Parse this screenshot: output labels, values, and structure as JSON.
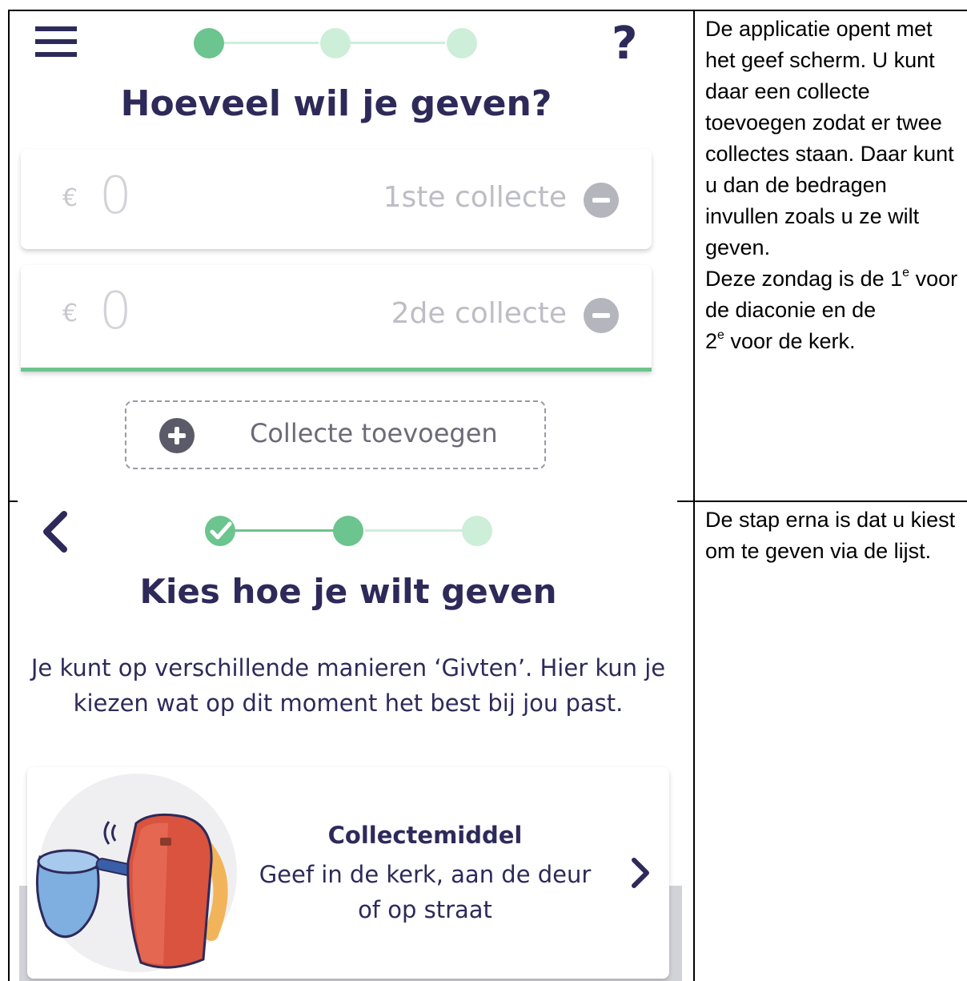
{
  "screen1": {
    "title": "Hoeveel wil je geven?",
    "help_label": "?",
    "collections": [
      {
        "currency": "€",
        "amount": "0",
        "label": "1ste collecte"
      },
      {
        "currency": "€",
        "amount": "0",
        "label": "2de collecte"
      }
    ],
    "add_label": "Collecte toevoegen",
    "steps_current": 1,
    "steps_total": 3
  },
  "note1": {
    "line1": "De applicatie opent met het geef scherm. U kunt daar een collecte toevoegen zodat er twee collectes staan. Daar kunt u dan de bedragen invullen zoals u ze wilt geven.",
    "line2a": "Deze zondag is de 1",
    "line2_sup": "e",
    "line2b": " voor de diaconie en de",
    "line3a": "2",
    "line3_sup": "e",
    "line3b": " voor de kerk."
  },
  "screen2": {
    "title": "Kies hoe je wilt geven",
    "description": "Je kunt op verschillende manieren ‘Givten’. Hier kun je kiezen wat op dit moment het best bij jou past.",
    "option": {
      "title": "Collectemiddel",
      "subtitle": "Geef in de kerk, aan de deur of op straat"
    },
    "steps_current": 2,
    "steps_total": 3
  },
  "note2": {
    "text": "De stap erna is dat u kiest om te geven via de lijst."
  },
  "colors": {
    "navy": "#2d2a5a",
    "green": "#6cc48e",
    "green_light": "#cdeed9",
    "grey": "#b5b5bd"
  }
}
